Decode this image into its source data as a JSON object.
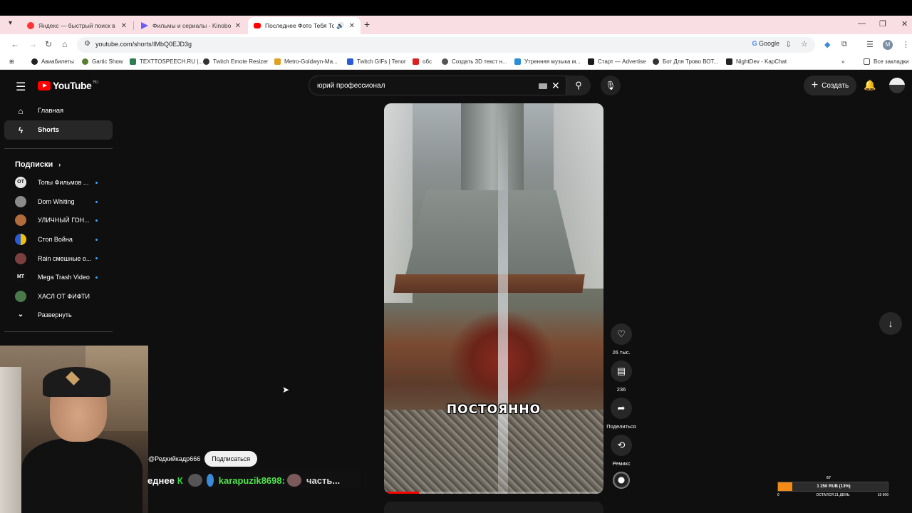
{
  "browser": {
    "tabs": [
      {
        "title": "Яндекс — быстрый поиск в ин",
        "favicon_color": "#ff3333"
      },
      {
        "title": "Фильмы и сериалы - Kinobox.",
        "favicon_color": "#6b5bff"
      },
      {
        "title": "Последнее Фото Тебя Точ",
        "favicon_color": "#ff0000",
        "active": true
      }
    ],
    "url": "youtube.com/shorts/IMbQ0EJD3g",
    "google_chip": "Google",
    "profile_letter": "M",
    "bookmarks": [
      {
        "label": "Авиабилеты",
        "color": "#222"
      },
      {
        "label": "Gartic Show",
        "color": "#5b7d2e"
      },
      {
        "label": "TEXTTOSPEECH.RU |...",
        "color": "#2a7d4f"
      },
      {
        "label": "Twitch Emote Resizer",
        "color": "#333"
      },
      {
        "label": "Metro-Goldwyn-Ma...",
        "color": "#e0a020"
      },
      {
        "label": "Twitch GIFs | Tenor",
        "color": "#2a5bd7"
      },
      {
        "label": "обс",
        "color": "#e01e1e"
      },
      {
        "label": "Создать 3D текст н...",
        "color": "#555"
      },
      {
        "label": "Утренняя музыка м...",
        "color": "#2a8fd7"
      },
      {
        "label": "Старт — Advertise",
        "color": "#1a1a1a"
      },
      {
        "label": "Бот Для Трово ВОТ...",
        "color": "#333"
      },
      {
        "label": "NightDev - KapChat",
        "color": "#222"
      }
    ],
    "all_bookmarks": "Все закладки"
  },
  "youtube": {
    "logo_text": "YouTube",
    "logo_region": "RU",
    "search_query": "юрий профессионал",
    "create_label": "Создать",
    "sidebar": {
      "home": "Главная",
      "shorts": "Shorts",
      "subs_heading": "Подписки",
      "subscriptions": [
        {
          "name": "Топы Фильмов ...",
          "avatar_color": "#e6e6e6",
          "avatar_text": "ОТ"
        },
        {
          "name": "Dom Whiting",
          "avatar_color": "#8a8a8a",
          "avatar_text": ""
        },
        {
          "name": "УЛИЧНЫЙ ГОН...",
          "avatar_color": "#b06c3c",
          "avatar_text": ""
        },
        {
          "name": "Стоп Война",
          "avatar_color": "#f2c200",
          "avatar_text": ""
        },
        {
          "name": "Rain смешные о...",
          "avatar_color": "#7a4040",
          "avatar_text": ""
        },
        {
          "name": "Mega Trash Video",
          "avatar_color": "#111",
          "avatar_text": "MT"
        },
        {
          "name": "ХАСЛ ОТ ФИФТИ",
          "avatar_color": "#4a7a4a",
          "avatar_text": ""
        }
      ],
      "expand": "Развернуть"
    },
    "video": {
      "caption": "ПОСТОЯННО",
      "progress": 0.16
    },
    "actions": {
      "likes": "26 тыс.",
      "comments": "236",
      "share": "Поделиться",
      "remix": "Ремикс"
    },
    "channel_handle": "@Редкийкадр666",
    "subscribe_label": "Подписаться"
  },
  "stream_overlay": {
    "chat_prefix": "еднее",
    "chat_k": "К",
    "chat_user": "karapuzik8698:",
    "chat_rest": "часть...",
    "donation": {
      "current": "67",
      "bar_text": "1 250 RUB (13%)",
      "percent": 0.13,
      "min": "0",
      "remaining": "ОСТАЛСЯ 21 ДЕНЬ",
      "goal": "10 000"
    }
  }
}
